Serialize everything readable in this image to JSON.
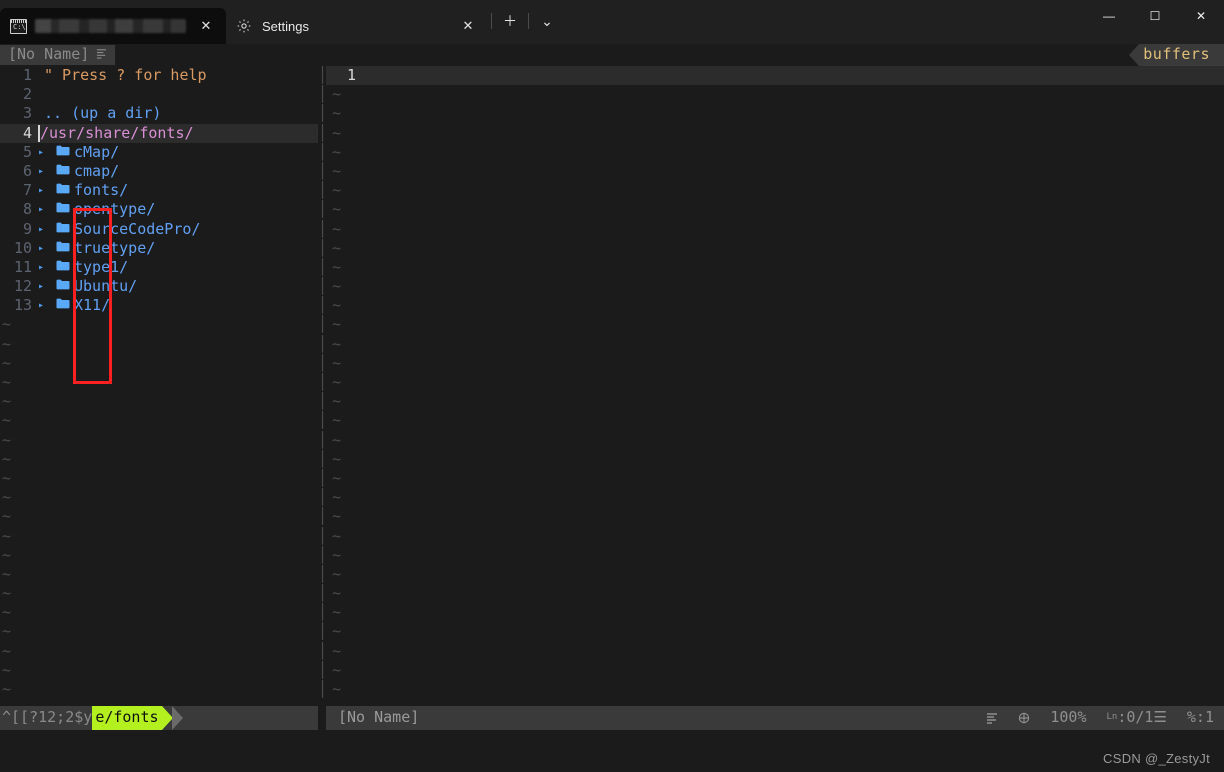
{
  "window": {
    "tabs": [
      {
        "icon": "command-prompt-icon",
        "title": "",
        "redacted": true,
        "close_label": "✕",
        "active": true
      },
      {
        "icon": "gear-icon",
        "title": "Settings",
        "close_label": "✕",
        "active": false
      }
    ],
    "new_tab_label": "＋",
    "dropdown_label": "⌄",
    "controls": {
      "minimize": "—",
      "maximize": "☐",
      "close": "✕"
    }
  },
  "editor": {
    "tabline": {
      "buffer_label": "[No Name]",
      "buffer_icon": "lines-icon",
      "right_label": "buffers"
    },
    "left_pane": {
      "header_comment": "\" Press ? for help",
      "up_dir": ".. (up a dir)",
      "current_path": "/usr/share/fonts/",
      "entries": [
        {
          "lnum": "5",
          "name": "cMap/"
        },
        {
          "lnum": "6",
          "name": "cmap/"
        },
        {
          "lnum": "7",
          "name": "fonts/"
        },
        {
          "lnum": "8",
          "name": "opentype/"
        },
        {
          "lnum": "9",
          "name": "SourceCodePro/"
        },
        {
          "lnum": "10",
          "name": "truetype/"
        },
        {
          "lnum": "11",
          "name": "type1/"
        },
        {
          "lnum": "12",
          "name": "Ubuntu/"
        },
        {
          "lnum": "13",
          "name": "X11/"
        }
      ],
      "line_numbers": [
        "1",
        "2",
        "3",
        "4"
      ],
      "expand_arrow": "▸",
      "folder_icon": "folder-icon",
      "tilde": "~"
    },
    "right_pane": {
      "first_line_number": "1",
      "tilde": "~"
    },
    "statusline": {
      "escape_text": "^[[?12;2$y",
      "path_segment": "e/fonts",
      "right_buffer": "[No Name]",
      "encoding_icon": "lines-icon",
      "lang_icon": "globe-icon",
      "zoom": "100%",
      "line_prefix": "Ln",
      "line_position": ":0/1",
      "column_icon": "☰",
      "percent": "%:1"
    },
    "colors": {
      "accent_green": "#b4f020",
      "folder_blue": "#5aa9f8",
      "path_pink": "#d98fd4",
      "comment_orange": "#d99a63",
      "annotation_red": "#fc2020",
      "buffers_gold": "#e0c07a"
    }
  },
  "annotation": {
    "name": "red-highlight-box"
  },
  "watermark": "CSDN @_ZestyJt"
}
